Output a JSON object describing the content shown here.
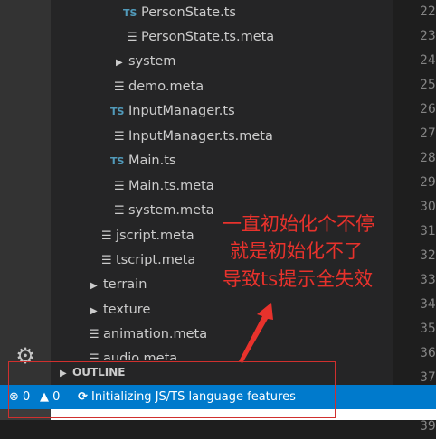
{
  "explorer": {
    "items": [
      {
        "label": "PersonState.ts",
        "icon": "ts-icon"
      },
      {
        "label": "PersonState.ts.meta",
        "icon": "file-icon"
      },
      {
        "label": "system",
        "icon": "chevron-right-icon"
      },
      {
        "label": "demo.meta",
        "icon": "file-icon"
      },
      {
        "label": "InputManager.ts",
        "icon": "ts-icon"
      },
      {
        "label": "InputManager.ts.meta",
        "icon": "file-icon"
      },
      {
        "label": "Main.ts",
        "icon": "ts-icon"
      },
      {
        "label": "Main.ts.meta",
        "icon": "file-icon"
      },
      {
        "label": "system.meta",
        "icon": "file-icon"
      },
      {
        "label": "jscript.meta",
        "icon": "file-icon"
      },
      {
        "label": "tscript.meta",
        "icon": "file-icon"
      },
      {
        "label": "terrain",
        "icon": "chevron-right-icon"
      },
      {
        "label": "texture",
        "icon": "chevron-right-icon"
      },
      {
        "label": "animation.meta",
        "icon": "file-icon"
      },
      {
        "label": "audio.meta",
        "icon": "file-icon"
      }
    ],
    "ts_icon_text": "TS"
  },
  "outline": {
    "label": "OUTLINE"
  },
  "line_numbers": [
    "22",
    "23",
    "24",
    "25",
    "26",
    "27",
    "28",
    "29",
    "30",
    "31",
    "32",
    "33",
    "34",
    "35",
    "36",
    "37",
    "38",
    "39"
  ],
  "statusbar": {
    "errors": "0",
    "warnings": "0",
    "message": "Initializing JS/TS language features"
  },
  "annotation": {
    "line1": "一直初始化个不停",
    "line2": "就是初始化不了",
    "line3": "导致ts提示全失效",
    "color": "#e8322c"
  }
}
